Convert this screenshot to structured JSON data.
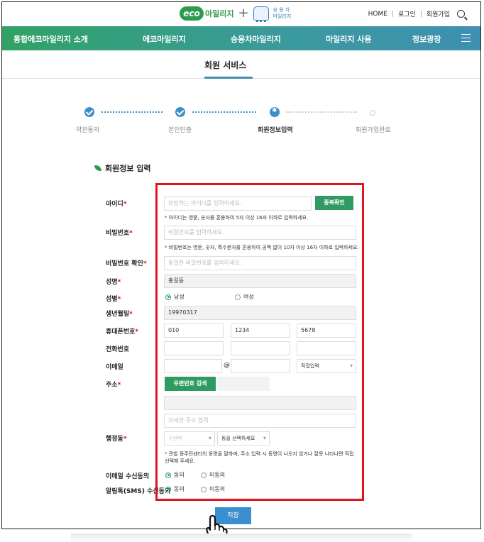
{
  "header": {
    "logo_eco": "eco",
    "logo_eco_text": "마일리지",
    "logo_plus": "+",
    "logo_car_line1": "승 용 차",
    "logo_car_line2": "마일리지",
    "links": [
      "HOME",
      "로그인",
      "회원가입"
    ],
    "separator": "|"
  },
  "nav": {
    "items": [
      "통합에코마일리지 소개",
      "에코마일리지",
      "승용차마일리지",
      "마일리지 사용",
      "정보광장"
    ]
  },
  "page_title": "회원 서비스",
  "steps": [
    {
      "label": "약관동의",
      "state": "done"
    },
    {
      "label": "본인인증",
      "state": "done"
    },
    {
      "label": "회원정보입력",
      "state": "current"
    },
    {
      "label": "회원가입완료",
      "state": "todo"
    }
  ],
  "section_title": "회원정보 입력",
  "required_mark": "*",
  "form": {
    "id": {
      "label": "아이디",
      "placeholder": "희망하는 아이디를 입력하세요.",
      "check_button": "중복확인",
      "hint": "아이디는 영문, 숫자를 혼용하여 5자 이상 16자 이하로 입력하세요."
    },
    "password": {
      "label": "비밀번호",
      "placeholder": "비밀번호를 입력하세요.",
      "hint": "비밀번호는 영문, 숫자, 특수문자를 혼용하여 공백 없이 10자 이상 16자 이하로 입력하세요."
    },
    "password_confirm": {
      "label": "비밀번호 확인",
      "placeholder": "동일한 비밀번호를 입력하세요."
    },
    "name": {
      "label": "성명",
      "value": "홍길동"
    },
    "gender": {
      "label": "성별",
      "options": [
        "남성",
        "여성"
      ],
      "selected": "남성"
    },
    "birth": {
      "label": "생년월일",
      "value": "19970317"
    },
    "mobile": {
      "label": "휴대폰번호",
      "values": [
        "010",
        "1234",
        "5678"
      ]
    },
    "phone": {
      "label": "전화번호"
    },
    "email": {
      "label": "이메일",
      "at": "@",
      "domain_select": "직접입력"
    },
    "address": {
      "label": "주소",
      "zip_button": "우편번호 검색",
      "detail_placeholder": "자세한 주소 입력"
    },
    "district": {
      "label": "행정동",
      "gu_select": "구선택",
      "dong_select": "동을 선택하세요",
      "hint": "관할 동주민센터의 동명을 말하며, 주소 입력 시 동명이 나오지 않거나 잘못 나타나면 직접 선택해 주세요."
    },
    "email_consent": {
      "label": "이메일 수신동의",
      "options": [
        "동의",
        "미동의"
      ],
      "selected": "동의"
    },
    "sms_consent": {
      "label": "알림톡(SMS) 수신동의",
      "options": [
        "동의",
        "미동의"
      ],
      "selected": "동의"
    }
  },
  "save_button": "저장",
  "colors": {
    "brand_green": "#2f9b63",
    "nav_blue": "#3f8fb2",
    "highlight_red": "#e2141b",
    "save_blue": "#3a8fd0"
  }
}
